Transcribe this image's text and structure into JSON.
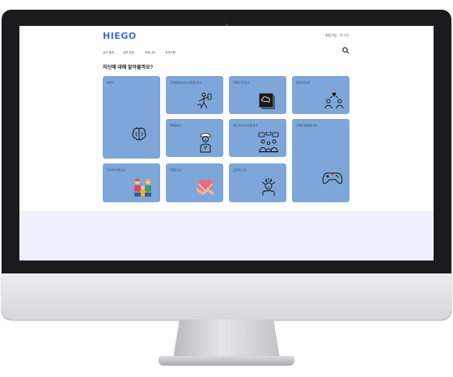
{
  "header": {
    "logo": "HIEGO",
    "util_links": [
      "회원가입",
      "로그인"
    ]
  },
  "nav": {
    "items": [
      "검사 결과",
      "심리 상담",
      "커뮤니티",
      "공지사항"
    ]
  },
  "heading": "자신에 대해 알아볼까요?",
  "cards": [
    {
      "title": "MMPI",
      "icon": "brain-icon"
    },
    {
      "title": "인터넷중독검사(스마트폰 검사)",
      "icon": "phone-addiction-icon"
    },
    {
      "title": "우울증 자가검사",
      "icon": "mind-cloud-icon"
    },
    {
      "title": "대인관계 검사",
      "icon": "people-relation-icon"
    },
    {
      "title": "우울증검사",
      "icon": "sad-person-icon"
    },
    {
      "title": "부모 자녀 의사소통 검사",
      "icon": "family-talk-icon"
    },
    {
      "title": "인터넷 게임중독 검사",
      "icon": "gamepad-icon"
    },
    {
      "title": "대인관계 문제 검사",
      "icon": "group-icon"
    },
    {
      "title": "자존감 검사",
      "icon": "heart-hug-icon"
    },
    {
      "title": "스트레스 검사",
      "icon": "stress-icon"
    }
  ],
  "colors": {
    "brand": "#3e6fd0",
    "card": "#7ea6d8",
    "bezel": "#1b1b1d",
    "footer_band": "#eef0fb"
  }
}
